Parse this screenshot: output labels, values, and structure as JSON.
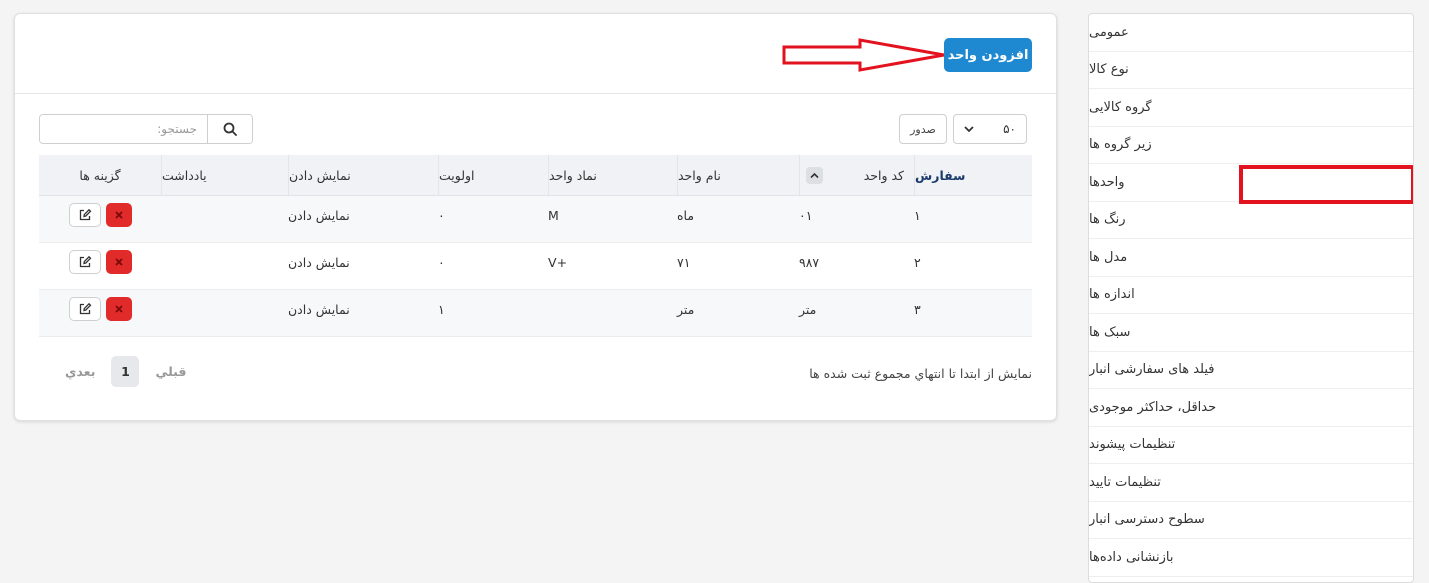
{
  "sidebar": {
    "items": [
      {
        "label": "عمومی"
      },
      {
        "label": "نوع کالا"
      },
      {
        "label": "گروه کالایی"
      },
      {
        "label": "زیر گروه ها"
      },
      {
        "label": "واحدها"
      },
      {
        "label": "رنگ ها"
      },
      {
        "label": "مدل ها"
      },
      {
        "label": "اندازه ها"
      },
      {
        "label": "سبک ها"
      },
      {
        "label": "فیلد های سفارشی انبار"
      },
      {
        "label": "حداقل، حداکثر موجودی"
      },
      {
        "label": "تنظیمات پیشوند"
      },
      {
        "label": "تنظیمات تایید"
      },
      {
        "label": "سطوح دسترسی انبار"
      },
      {
        "label": "بازنشانی دادەها"
      }
    ],
    "highlight_color": "#e3121f"
  },
  "header": {
    "add_button_label": "افزودن واحد",
    "accent_color": "#1e88d0"
  },
  "controls": {
    "search_placeholder": "جستجو:",
    "export_label": "صدور",
    "page_size": "۵۰"
  },
  "table": {
    "columns": {
      "order": "سفارش",
      "code": "کد واحد",
      "name": "نام واحد",
      "symbol": "نماد واحد",
      "priority": "اولویت",
      "display": "نمایش دادن",
      "note": "یادداشت",
      "options": "گزینه ها"
    },
    "rows": [
      {
        "order": "۱",
        "code": "۰۱",
        "name": "ماه",
        "symbol": "M",
        "priority": "۰",
        "display": "نمایش دادن",
        "note": ""
      },
      {
        "order": "۲",
        "code": "۹۸۷",
        "name": "۷۱",
        "symbol": "+V",
        "priority": "۰",
        "display": "نمایش دادن",
        "note": ""
      },
      {
        "order": "۳",
        "code": "متر",
        "name": "متر",
        "symbol": "",
        "priority": "۱",
        "display": "نمایش دادن",
        "note": ""
      }
    ]
  },
  "footer": {
    "info": "نمایش از ابتدا تا انتهاي مجموع ثبت شده ها",
    "prev": "قبلي",
    "current_page": "1",
    "next": "بعدي"
  }
}
